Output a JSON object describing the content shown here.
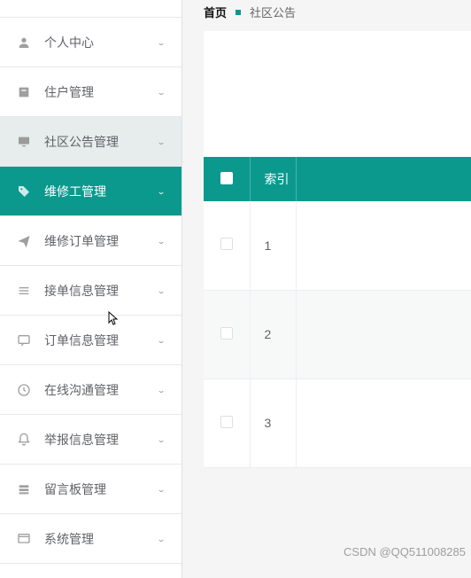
{
  "breadcrumb": {
    "home": "首页",
    "current": "社区公告"
  },
  "sidebar": {
    "items": [
      {
        "label": "个人中心",
        "icon": "user",
        "level": "1",
        "active": false
      },
      {
        "label": "住户管理",
        "icon": "box",
        "level": "1",
        "active": false
      },
      {
        "label": "社区公告管理",
        "icon": "monitor",
        "level": "2",
        "active": false
      },
      {
        "label": "维修工管理",
        "icon": "tag",
        "level": "2",
        "active": true
      },
      {
        "label": "维修订单管理",
        "icon": "send",
        "level": "1",
        "active": false
      },
      {
        "label": "接单信息管理",
        "icon": "list",
        "level": "1",
        "active": false
      },
      {
        "label": "订单信息管理",
        "icon": "chat",
        "level": "1",
        "active": false
      },
      {
        "label": "在线沟通管理",
        "icon": "clock",
        "level": "1",
        "active": false
      },
      {
        "label": "举报信息管理",
        "icon": "bell",
        "level": "1",
        "active": false
      },
      {
        "label": "留言板管理",
        "icon": "layers",
        "level": "1",
        "active": false
      },
      {
        "label": "系统管理",
        "icon": "window",
        "level": "1",
        "active": false
      }
    ]
  },
  "table": {
    "headers": {
      "index": "索引"
    },
    "rows": [
      {
        "idx": "1"
      },
      {
        "idx": "2"
      },
      {
        "idx": "3"
      }
    ]
  },
  "watermark": "CSDN @QQ511008285"
}
